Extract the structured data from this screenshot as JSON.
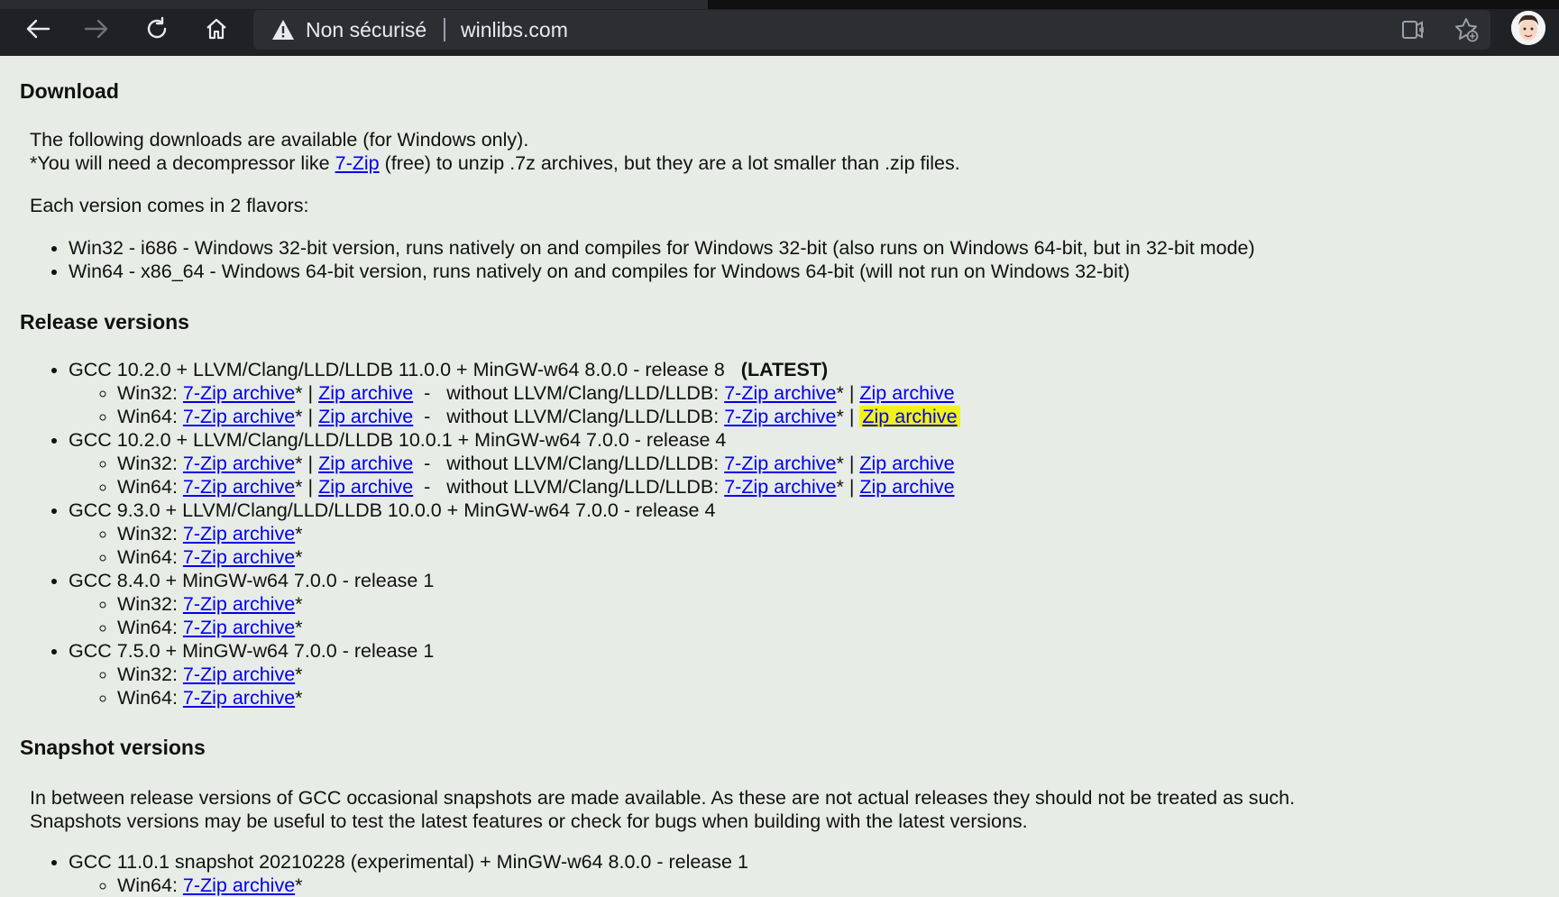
{
  "browser": {
    "security_label": "Non sécurisé",
    "url": "winlibs.com"
  },
  "page": {
    "download_heading": "Download",
    "intro_line1": "The following downloads are available (for Windows only).",
    "intro_line2_prefix": "*You will need a decompressor like ",
    "intro_link_7zip": "7-Zip",
    "intro_line2_suffix": " (free) to unzip .7z archives, but they are a lot smaller than .zip files.",
    "flavors_intro": "Each version comes in 2 flavors:",
    "flavors": [
      "Win32 - i686 - Windows 32-bit version, runs natively on and compiles for Windows 32-bit (also runs on Windows 64-bit, but in 32-bit mode)",
      "Win64 - x86_64 - Windows 64-bit version, runs natively on and compiles for Windows 64-bit (will not run on Windows 32-bit)"
    ],
    "release_heading": "Release versions",
    "labels": {
      "win32": "Win32: ",
      "win64": "Win64: ",
      "seven_zip": "7-Zip archive",
      "zip": "Zip archive",
      "star": "*",
      "pipe": " | ",
      "without": "  -   without LLVM/Clang/LLD/LLDB: ",
      "latest": "(LATEST)"
    },
    "releases": [
      "GCC 10.2.0 + LLVM/Clang/LLD/LLDB 11.0.0 + MinGW-w64 8.0.0 - release 8",
      "GCC 10.2.0 + LLVM/Clang/LLD/LLDB 10.0.1 + MinGW-w64 7.0.0 - release 4",
      "GCC 9.3.0 + LLVM/Clang/LLD/LLDB 10.0.0 + MinGW-w64 7.0.0 - release 4",
      "GCC 8.4.0 + MinGW-w64 7.0.0 - release 1",
      "GCC 7.5.0 + MinGW-w64 7.0.0 - release 1"
    ],
    "snapshot_heading": "Snapshot versions",
    "snapshot_line1": "In between release versions of GCC occasional snapshots are made available. As these are not actual releases they should not be treated as such.",
    "snapshot_line2": "Snapshots versions may be useful to test the latest features or check for bugs when building with the latest versions.",
    "snapshots": [
      "GCC 11.0.1 snapshot 20210228 (experimental) + MinGW-w64 8.0.0 - release 1"
    ]
  },
  "colors": {
    "page_bg": "#e8ece7",
    "link": "#0000ee",
    "highlight": "#f2f21a",
    "toolbar_bg": "#202124"
  }
}
